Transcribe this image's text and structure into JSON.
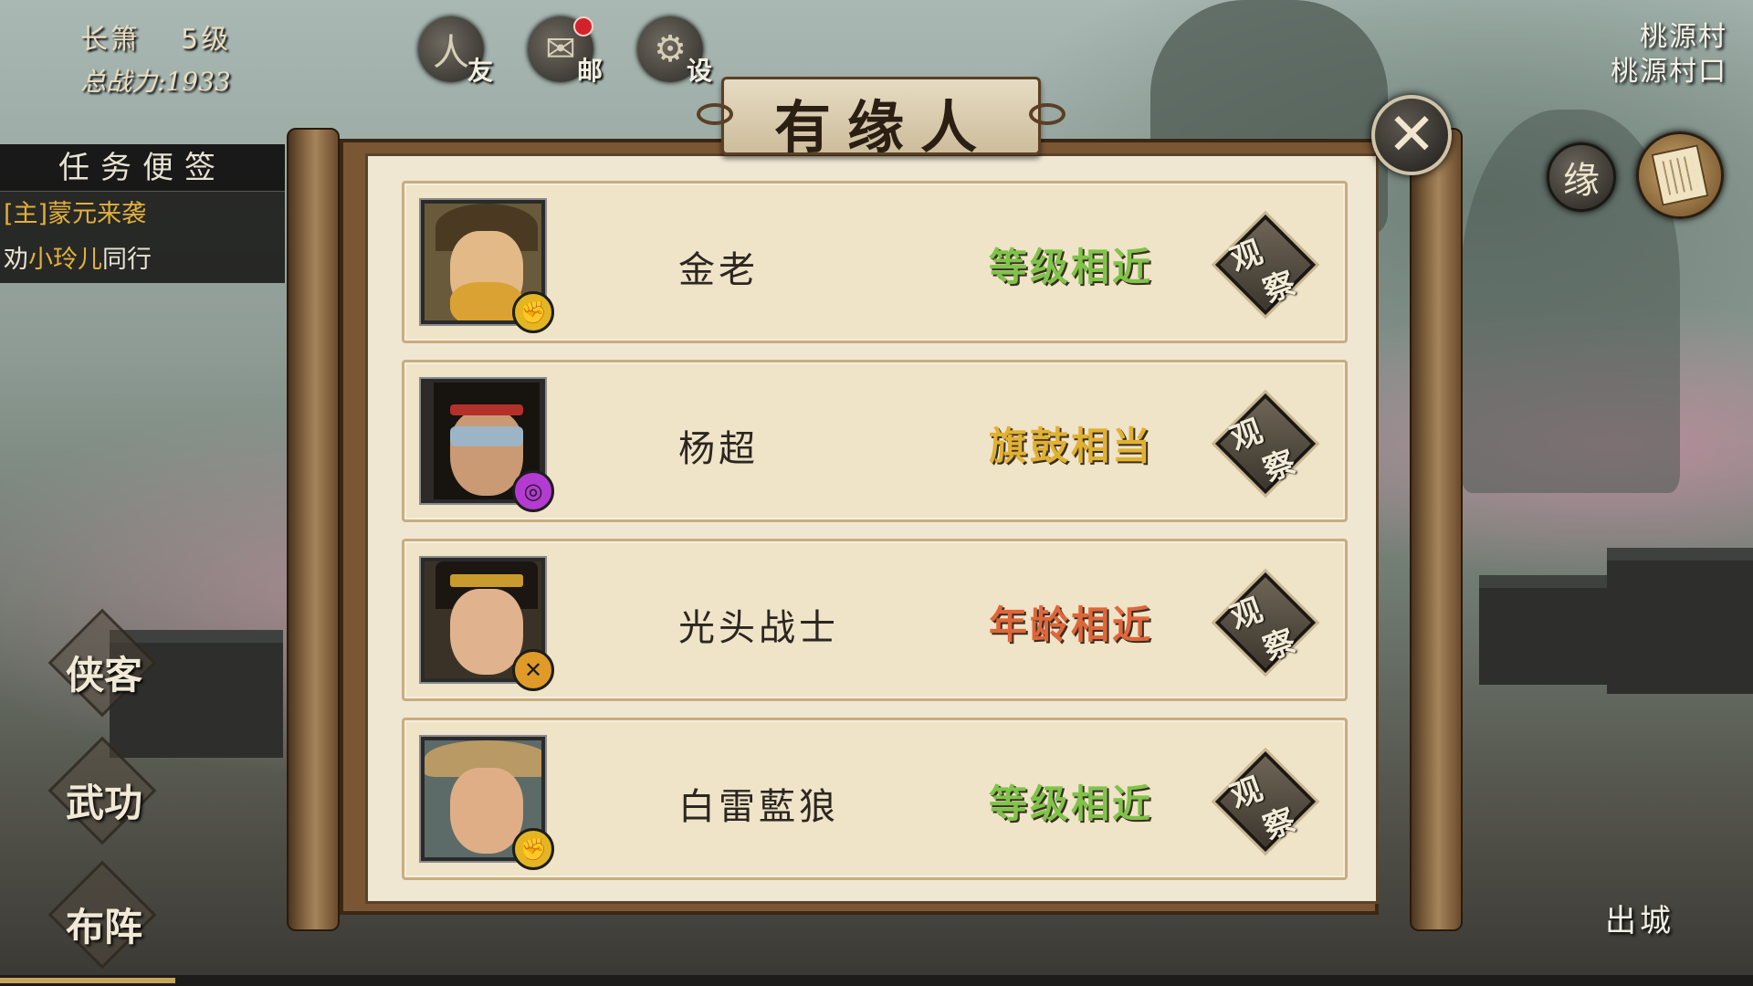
{
  "player": {
    "name": "长箫",
    "level": "5级",
    "power": "总战力:1933"
  },
  "top_icons": [
    {
      "name": "friends",
      "label": "友",
      "glyph": "人"
    },
    {
      "name": "mail",
      "label": "邮",
      "glyph": "✉"
    },
    {
      "name": "settings",
      "label": "设",
      "glyph": "⚙"
    }
  ],
  "location": {
    "area": "桃源村",
    "spot": "桃源村口"
  },
  "right_buttons": {
    "fate_label": "缘"
  },
  "tasks": {
    "header": "任务便签",
    "main_quest": "[主]蒙元来袭",
    "sub_quest_prefix": "劝",
    "sub_quest_person": "小玲儿",
    "sub_quest_suffix": "同行"
  },
  "side_menu": [
    "侠客",
    "武功",
    "布阵"
  ],
  "exit_label": "出城",
  "dialog": {
    "title": "有缘人",
    "observe_chars": [
      "观",
      "察"
    ],
    "rows": [
      {
        "name": "金老",
        "tag": "等级相近",
        "tag_color": "#7fc34a",
        "badge_type": "fist-icon",
        "badge_color": "#e4b522",
        "badge_glyph": "✊"
      },
      {
        "name": "杨超",
        "tag": "旗鼓相当",
        "tag_color": "#e0b132",
        "badge_type": "swirl-icon",
        "badge_color": "#b43bd1",
        "badge_glyph": "◎"
      },
      {
        "name": "光头战士",
        "tag": "年龄相近",
        "tag_color": "#e0663a",
        "badge_type": "sword-icon",
        "badge_color": "#e09a28",
        "badge_glyph": "✕"
      },
      {
        "name": "白雷藍狼",
        "tag": "等级相近",
        "tag_color": "#7fc34a",
        "badge_type": "fist-icon",
        "badge_color": "#e4b522",
        "badge_glyph": "✊"
      }
    ]
  },
  "progress": {
    "fraction": 0.1
  }
}
